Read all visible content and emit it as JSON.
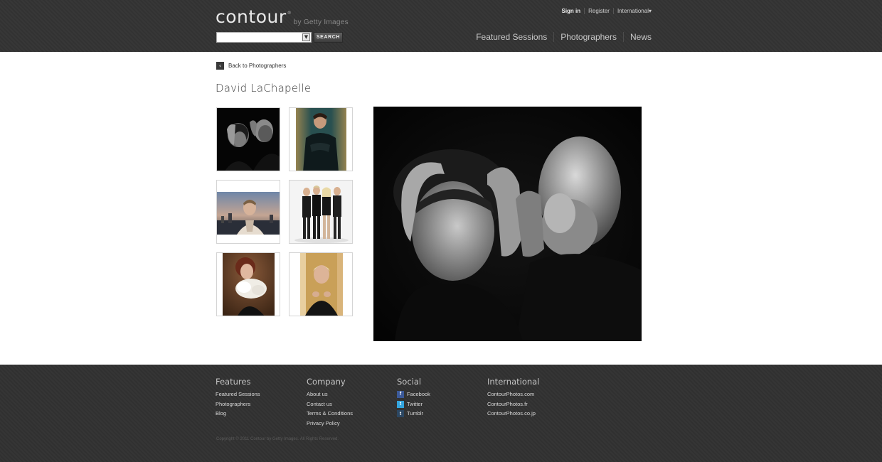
{
  "header": {
    "logo_text": "contour",
    "logo_reg": "®",
    "logo_sub": "by Getty Images",
    "search_button": "SEARCH",
    "search_dropdown_icon": "chevron-down-icon",
    "top_links": [
      "Sign in",
      "Register",
      "International"
    ],
    "international_icon": "▾",
    "nav": [
      "Featured Sessions",
      "Photographers",
      "News"
    ]
  },
  "content": {
    "back_icon": "‹",
    "back_label": "Back to Photographers",
    "title": "David LaChapelle"
  },
  "footer": {
    "columns": [
      {
        "heading": "Features",
        "links": [
          "Featured Sessions",
          "Photographers",
          "Blog"
        ]
      },
      {
        "heading": "Company",
        "links": [
          "About us",
          "Contact us",
          "Terms & Conditions",
          "Privacy Policy"
        ]
      },
      {
        "heading": "Social",
        "links": [
          "Facebook",
          "Twitter",
          "Tumblr"
        ],
        "icons": [
          "f",
          "t",
          "t"
        ],
        "icon_colors": [
          "#3b5998",
          "#33a3dc",
          "#2c4762"
        ]
      },
      {
        "heading": "International",
        "links": [
          "ContourPhotos.com",
          "ContourPhotos.fr",
          "ContourPhotos.co.jp"
        ]
      }
    ],
    "copyright": "Copyright © 2011 Contour by Getty Images. All Rights Reserved."
  }
}
